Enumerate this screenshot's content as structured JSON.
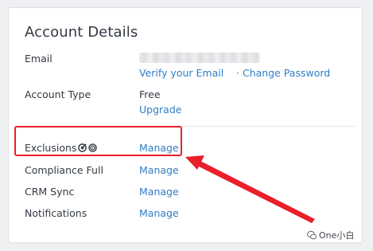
{
  "card": {
    "title": "Account Details"
  },
  "email": {
    "label": "Email",
    "verify_link": "Verify your Email",
    "separator": "·",
    "change_password_link": "Change Password"
  },
  "account_type": {
    "label": "Account Type",
    "value": "Free",
    "upgrade_link": "Upgrade"
  },
  "rows": [
    {
      "label": "Exclusions",
      "action": "Manage"
    },
    {
      "label": "Compliance Full",
      "action": "Manage"
    },
    {
      "label": "CRM Sync",
      "action": "Manage"
    },
    {
      "label": "Notifications",
      "action": "Manage"
    }
  ],
  "icons": {
    "exclusion_icon_1": "target-check-icon",
    "exclusion_icon_2": "target-icon"
  },
  "annotation": {
    "highlight_color": "#e8202a"
  },
  "watermark": {
    "text": "One小白"
  },
  "colors": {
    "link": "#2f7ec7",
    "text": "#333a44"
  }
}
